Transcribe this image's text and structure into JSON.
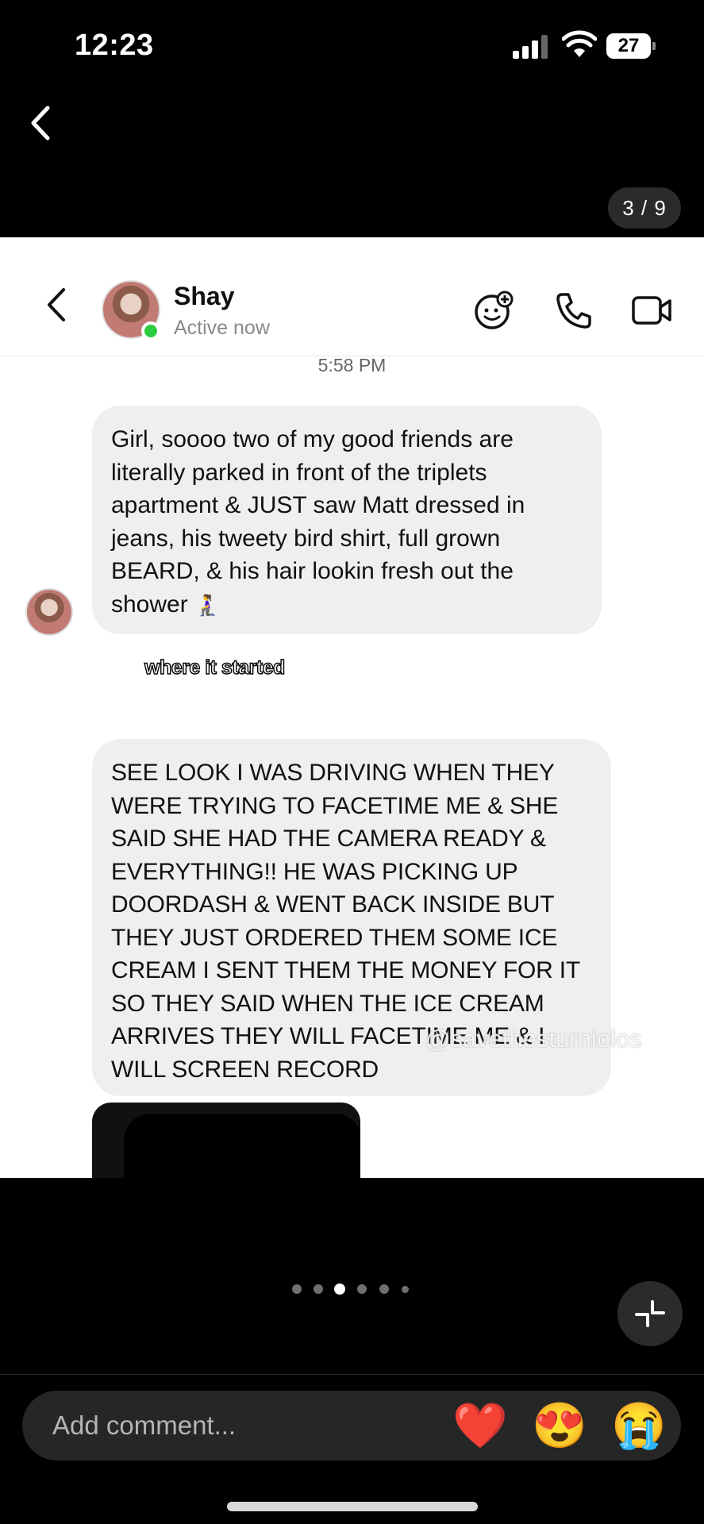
{
  "status_bar": {
    "time": "12:23",
    "battery": "27",
    "icons": [
      "signal-icon",
      "wifi-icon",
      "battery-icon"
    ]
  },
  "viewer": {
    "counter": "3 / 9",
    "active_page": 3,
    "total_dots": 6
  },
  "conversation": {
    "contact_name": "Shay",
    "contact_status": "Active now",
    "header_icons": [
      "sticker-icon",
      "phone-icon",
      "video-icon"
    ],
    "timestamp": "5:58 PM",
    "messages": [
      {
        "text": "Girl, soooo two of my good friends are literally parked in front of the triplets apartment & JUST saw Matt dressed in jeans, his tweety bird shirt, full grown BEARD, & his hair lookin fresh out the shower",
        "emoji": "🧎‍♀️"
      },
      {
        "text": "SEE LOOK I WAS DRIVING WHEN THEY WERE TRYING TO FACETIME ME & SHE SAID SHE HAD THE CAMERA READY & EVERYTHING!! HE WAS PICKING UP DOORDASH & WENT BACK INSIDE BUT THEY JUST ORDERED THEM SOME ICE CREAM I SENT THEM THE MONEY FOR IT SO THEY SAID WHEN THE ICE CREAM ARRIVES THEY WILL FACETIME ME & I WILL SCREEN RECORD"
      }
    ],
    "caption": "where it started",
    "watermark": "@savethesturniolos"
  },
  "comment_bar": {
    "placeholder": "Add comment...",
    "reactions": [
      "❤️",
      "😍",
      "😭"
    ]
  }
}
